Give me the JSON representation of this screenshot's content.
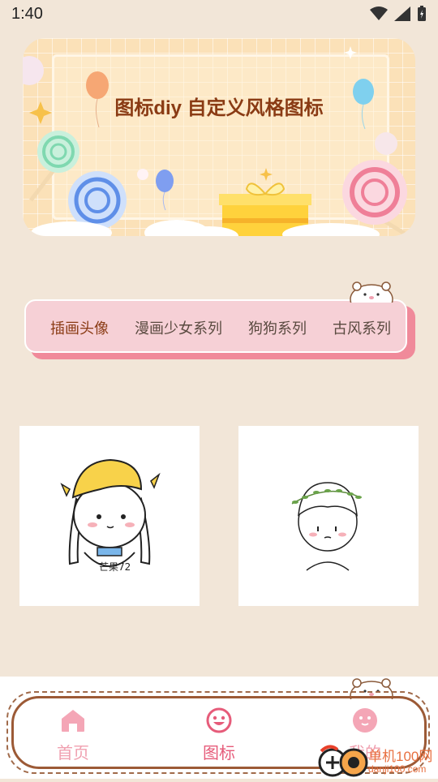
{
  "status_bar": {
    "time": "1:40"
  },
  "banner": {
    "title": "图标diy 自定义风格图标"
  },
  "category_tabs": [
    {
      "label": "插画头像",
      "active": true
    },
    {
      "label": "漫画少女系列",
      "active": false
    },
    {
      "label": "狗狗系列",
      "active": false
    },
    {
      "label": "古风系列",
      "active": false
    }
  ],
  "gallery": {
    "cards": [
      {
        "name": "girl-illustration",
        "signature": "芒果72"
      },
      {
        "name": "boy-illustration"
      }
    ]
  },
  "bottom_nav": {
    "items": [
      {
        "label": "首页",
        "icon": "home-icon",
        "active": false
      },
      {
        "label": "图标",
        "icon": "smile-icon",
        "active": true
      },
      {
        "label": "我的",
        "icon": "profile-icon",
        "active": false
      }
    ]
  },
  "watermark": {
    "text": "单机100网",
    "sub": "danji100.com"
  },
  "colors": {
    "background": "#f2e6d8",
    "tab_card": "#f6d0d6",
    "accent_pink": "#e65c7a",
    "nav_border": "#9c5a36"
  }
}
